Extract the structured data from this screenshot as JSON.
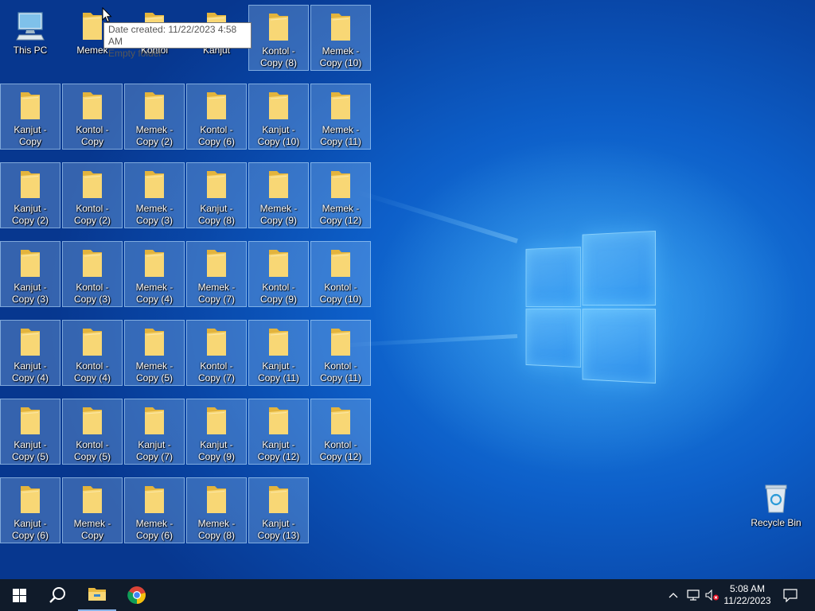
{
  "desktop": {
    "icons": [
      {
        "label": "This PC",
        "type": "pc"
      },
      {
        "label": "Memek",
        "type": "folder"
      },
      {
        "label": "Kontol",
        "type": "folder"
      },
      {
        "label": "Kanjut",
        "type": "folder"
      },
      {
        "label": "Kontol - Copy (8)",
        "type": "folder"
      },
      {
        "label": "Memek - Copy (10)",
        "type": "folder"
      },
      {
        "label": "Kanjut - Copy",
        "type": "folder"
      },
      {
        "label": "Kontol - Copy",
        "type": "folder"
      },
      {
        "label": "Memek - Copy (2)",
        "type": "folder"
      },
      {
        "label": "Kontol - Copy (6)",
        "type": "folder"
      },
      {
        "label": "Kanjut - Copy (10)",
        "type": "folder"
      },
      {
        "label": "Memek - Copy (11)",
        "type": "folder"
      },
      {
        "label": "Kanjut - Copy (2)",
        "type": "folder"
      },
      {
        "label": "Kontol - Copy (2)",
        "type": "folder"
      },
      {
        "label": "Memek - Copy (3)",
        "type": "folder"
      },
      {
        "label": "Kanjut - Copy (8)",
        "type": "folder"
      },
      {
        "label": "Memek - Copy (9)",
        "type": "folder"
      },
      {
        "label": "Memek - Copy (12)",
        "type": "folder"
      },
      {
        "label": "Kanjut - Copy (3)",
        "type": "folder"
      },
      {
        "label": "Kontol - Copy (3)",
        "type": "folder"
      },
      {
        "label": "Memek - Copy (4)",
        "type": "folder"
      },
      {
        "label": "Memek - Copy (7)",
        "type": "folder"
      },
      {
        "label": "Kontol - Copy (9)",
        "type": "folder"
      },
      {
        "label": "Kontol - Copy (10)",
        "type": "folder"
      },
      {
        "label": "Kanjut - Copy (4)",
        "type": "folder"
      },
      {
        "label": "Kontol - Copy (4)",
        "type": "folder"
      },
      {
        "label": "Memek - Copy (5)",
        "type": "folder"
      },
      {
        "label": "Kontol - Copy (7)",
        "type": "folder"
      },
      {
        "label": "Kanjut - Copy (11)",
        "type": "folder"
      },
      {
        "label": "Kontol - Copy (11)",
        "type": "folder"
      },
      {
        "label": "Kanjut - Copy (5)",
        "type": "folder"
      },
      {
        "label": "Kontol - Copy (5)",
        "type": "folder"
      },
      {
        "label": "Kanjut - Copy (7)",
        "type": "folder"
      },
      {
        "label": "Kanjut - Copy (9)",
        "type": "folder"
      },
      {
        "label": "Kanjut - Copy (12)",
        "type": "folder"
      },
      {
        "label": "Kontol - Copy (12)",
        "type": "folder"
      },
      {
        "label": "Kanjut - Copy (6)",
        "type": "folder"
      },
      {
        "label": "Memek - Copy",
        "type": "folder"
      },
      {
        "label": "Memek - Copy (6)",
        "type": "folder"
      },
      {
        "label": "Memek - Copy (8)",
        "type": "folder"
      },
      {
        "label": "Kanjut - Copy (13)",
        "type": "folder"
      }
    ],
    "recycle_bin_label": "Recycle Bin",
    "tooltip": {
      "line1": "Date created: 11/22/2023 4:58 AM",
      "line2": "Empty folder"
    }
  },
  "taskbar": {
    "start_icon": "windows-logo-icon",
    "search_icon": "search-icon",
    "pinned": [
      "file-explorer-icon",
      "chrome-icon"
    ],
    "tray": {
      "time": "5:08 AM",
      "date": "11/22/2023",
      "icons": [
        "chevron-up-icon",
        "network-icon",
        "speaker-muted-icon",
        "notification-icon"
      ]
    }
  },
  "colors": {
    "taskbar_bg": "#101b2a",
    "folder_yellow": "#f8d775",
    "folder_dark": "#e3b43d"
  }
}
